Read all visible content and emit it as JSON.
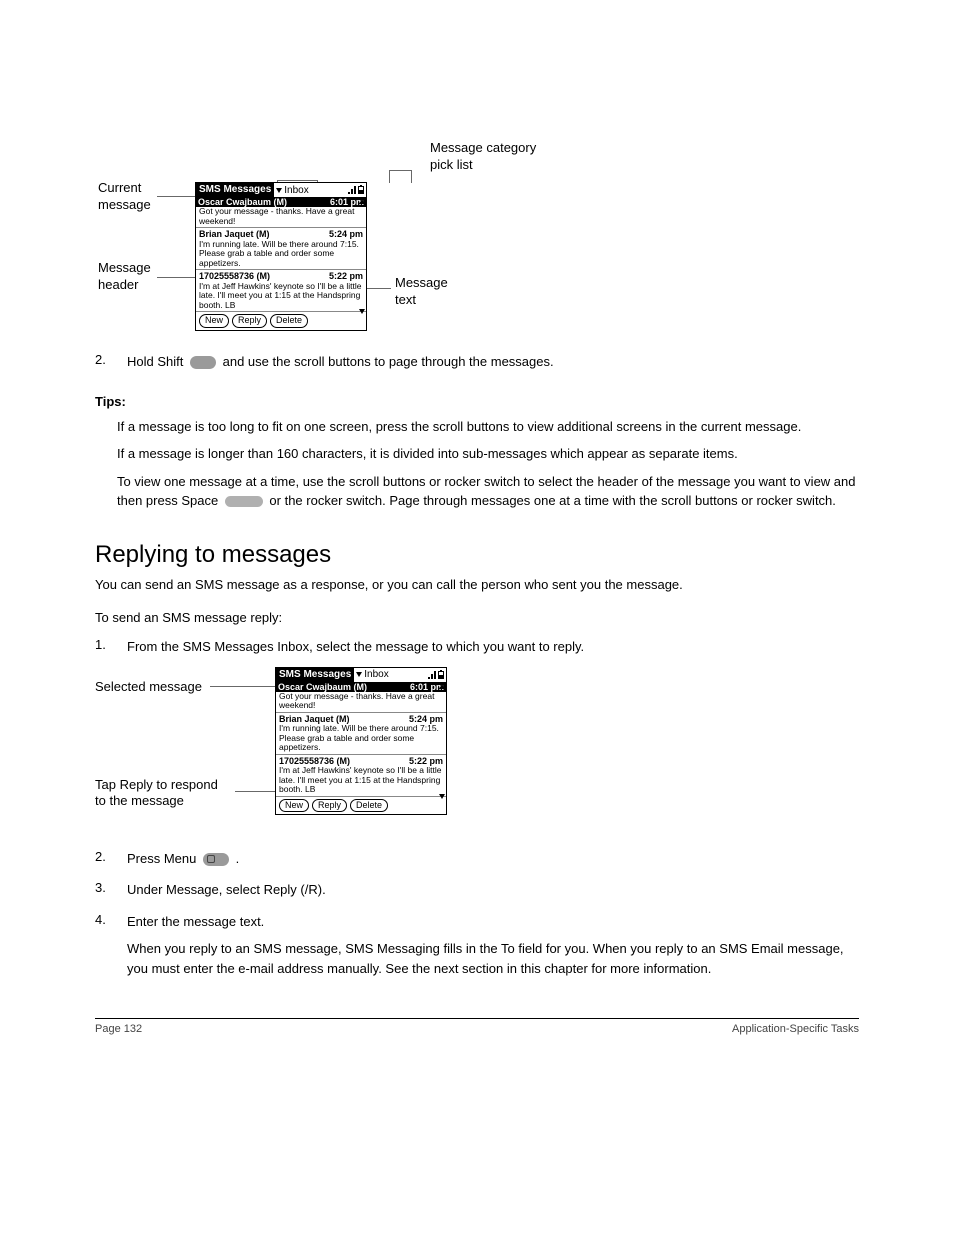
{
  "fig1": {
    "callout_category": "Message category\npick list",
    "callout_current": "Current\nmessage",
    "callout_header": "Message\nheader",
    "callout_text": "Message\ntext"
  },
  "palm": {
    "title": "SMS Messages",
    "picklist": "Inbox",
    "messages": [
      {
        "from": "Oscar Cwajbaum (M)",
        "time": "6:01 pm",
        "text": "Got your message - thanks. Have a great weekend!"
      },
      {
        "from": "Brian Jaquet (M)",
        "time": "5:24 pm",
        "text": "I'm running late. Will be there around 7:15. Please grab a table and order some appetizers."
      },
      {
        "from": "17025558736 (M)",
        "time": "5:22 pm",
        "text": "I'm at Jeff Hawkins' keynote so I'll be a little late. I'll meet you at 1:15 at the Handspring booth. LB"
      }
    ],
    "btn_new": "New",
    "btn_reply": "Reply",
    "btn_delete": "Delete"
  },
  "step2": {
    "num": "2.",
    "text_a": "Hold Shift ",
    "text_b": " and use the scroll buttons to page through the messages."
  },
  "tips_label": "Tips:",
  "tip1": "If a message is too long to fit on one screen, press the scroll buttons to view additional screens in the current message.",
  "tip2": "If a message is longer than 160 characters, it is divided into sub-messages which appear as separate items.",
  "tip3_a": "To view one message at a time, use the scroll buttons or rocker switch to select the header of the message you want to view and then press Space ",
  "tip3_b": " or the rocker switch. Page through messages one at a time with the scroll buttons or rocker switch.",
  "section_title": "Replying to messages",
  "section_intro": "You can send an SMS message as a response, or you can call the person who sent you the message.",
  "subhead": "To send an SMS message reply:",
  "r1": {
    "num": "1.",
    "text": "From the SMS Messages Inbox, select the message to which you want to reply."
  },
  "fig2": {
    "callout_selected": "Selected message",
    "callout_reply": "Tap Reply to respond\nto the message"
  },
  "r2": {
    "num": "2.",
    "text_a": "Press Menu ",
    "text_b": "."
  },
  "r3": {
    "num": "3.",
    "text": "Under Message, select Reply (/R)."
  },
  "r4": {
    "num": "4.",
    "text": "Enter the message text."
  },
  "r4_para": "When you reply to an SMS message, SMS Messaging fills in the To field for you. When you reply to an SMS Email message, you must enter the e-mail address manually. See the next section in this chapter for more information.",
  "footer_left": "Page 132",
  "footer_right": "Application-Specific Tasks"
}
